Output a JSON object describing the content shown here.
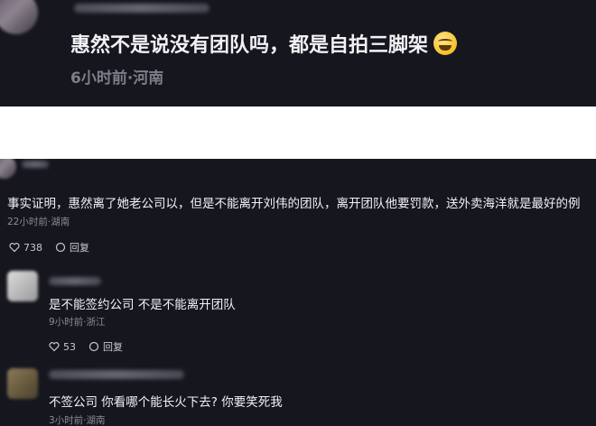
{
  "top_comment": {
    "text": "惠然不是说没有团队吗，都是自拍三脚架",
    "emoji": "grinning-sweat-emoji",
    "meta": "6小时前·河南"
  },
  "comments": [
    {
      "text": "事实证明，惠然离了她老公司以，但是不能离开刘伟的团队，离开团队他要罚款，送外卖海洋就是最好的例",
      "meta": "22小时前·湖南",
      "likes": "738",
      "reply_label": "回复"
    },
    {
      "text": "是不能签约公司 不是不能离开团队",
      "meta": "9小时前·浙江",
      "likes": "53",
      "reply_label": "回复"
    },
    {
      "text": "不签公司 你看哪个能长火下去? 你要笑死我",
      "meta": "3小时前·湖南"
    }
  ],
  "colors": {
    "background": "#16161f",
    "text": "#f2f2f5",
    "meta": "#8b8b95"
  }
}
